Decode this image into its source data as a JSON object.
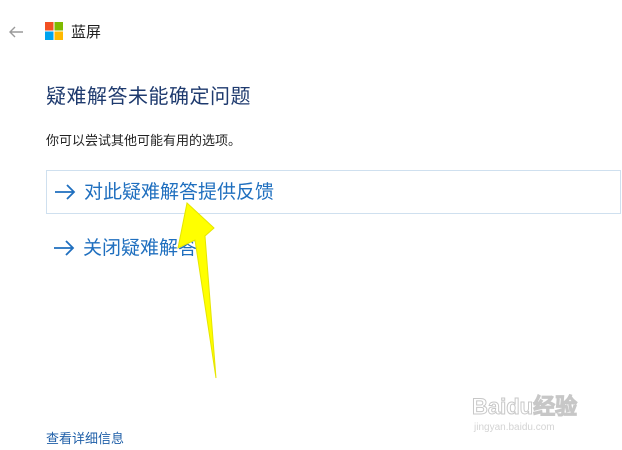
{
  "header": {
    "back_icon": "back-arrow-icon",
    "app_logo": "windows-logo-icon",
    "app_title": "蓝屏"
  },
  "main": {
    "heading": "疑难解答未能确定问题",
    "description": "你可以尝试其他可能有用的选项。",
    "actions": [
      {
        "icon": "right-arrow-icon",
        "label": "对此疑难解答提供反馈"
      },
      {
        "icon": "right-arrow-icon",
        "label": "关闭疑难解答"
      }
    ],
    "details_link": "查看详细信息"
  },
  "overlay": {
    "annotation": "yellow-arrow-annotation",
    "annotation_color": "#ffff00",
    "watermark_text": "Baidu经验",
    "watermark_url": "jingyan.baidu.com"
  },
  "colors": {
    "link": "#1f6fbf",
    "heading": "#1e3a6e",
    "row_border": "#cfe0ef"
  }
}
